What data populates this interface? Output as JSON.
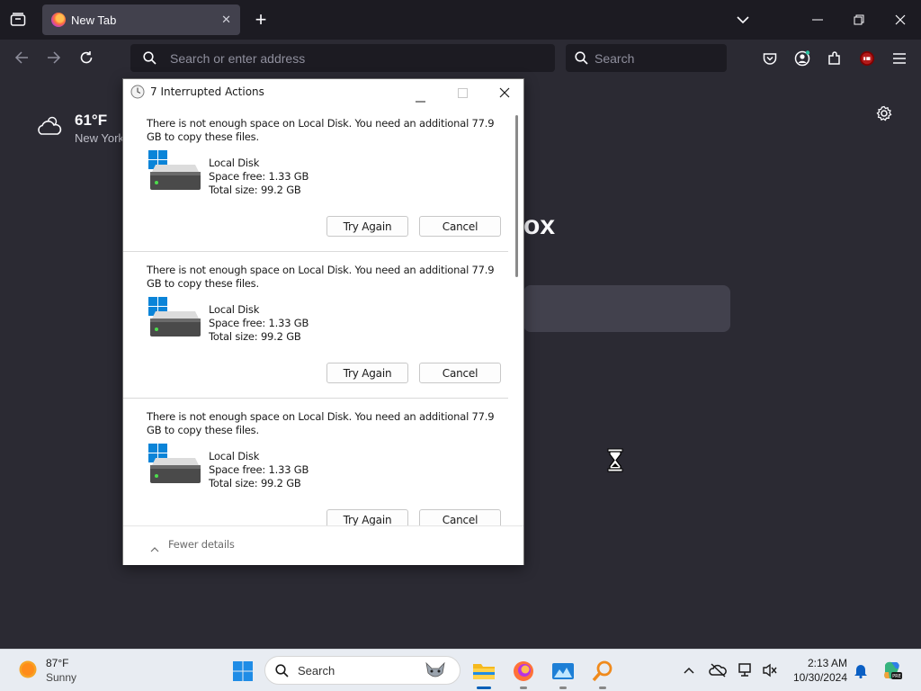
{
  "browser": {
    "tab": {
      "title": "New Tab",
      "close_glyph": "✕"
    },
    "new_tab_glyph": "+",
    "url_placeholder": "Search or enter address",
    "search_placeholder": "Search"
  },
  "newtab": {
    "weather": {
      "temp": "61°F",
      "city": "New York"
    },
    "brand_fragment": "ox"
  },
  "dialog": {
    "title": "7 Interrupted Actions",
    "items": [
      {
        "message": "There is not enough space on Local Disk. You need an additional 77.9 GB to copy these files.",
        "disk_name": "Local Disk",
        "space_free": "Space free: 1.33 GB",
        "total_size": "Total size: 99.2 GB",
        "retry_label": "Try Again",
        "cancel_label": "Cancel"
      },
      {
        "message": "There is not enough space on Local Disk. You need an additional 77.9 GB to copy these files.",
        "disk_name": "Local Disk",
        "space_free": "Space free: 1.33 GB",
        "total_size": "Total size: 99.2 GB",
        "retry_label": "Try Again",
        "cancel_label": "Cancel"
      },
      {
        "message": "There is not enough space on Local Disk. You need an additional 77.9 GB to copy these files.",
        "disk_name": "Local Disk",
        "space_free": "Space free: 1.33 GB",
        "total_size": "Total size: 99.2 GB",
        "retry_label": "Try Again",
        "cancel_label": "Cancel"
      }
    ],
    "footer": {
      "fewer_details": "Fewer details"
    }
  },
  "taskbar": {
    "weather": {
      "temp": "87°F",
      "condition": "Sunny"
    },
    "search_placeholder": "Search",
    "clock": {
      "time": "2:13 AM",
      "date": "10/30/2024"
    }
  },
  "colors": {
    "browser_bg": "#2b2a33",
    "tabbar_bg": "#1c1b22",
    "taskbar_bg": "#e8ecf2",
    "accent": "#005fb8"
  }
}
